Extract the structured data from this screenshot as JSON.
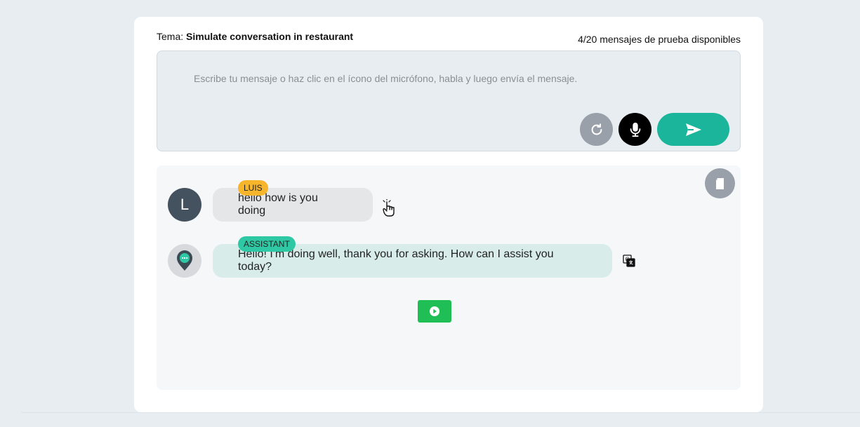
{
  "header": {
    "topic_label": "Tema:",
    "topic_value": "Simulate conversation in restaurant",
    "counter": "4/20 mensajes de prueba disponibles"
  },
  "composer": {
    "value": "",
    "placeholder": "Escribe tu mensaje o haz clic en el ícono del micrófono, habla y luego envía el mensaje."
  },
  "chat": {
    "messages": [
      {
        "role_tag": "LUIS",
        "avatar_letter": "L",
        "text": "hello how is you doing"
      },
      {
        "role_tag": "ASSISTANT",
        "text": "Hello! I'm doing well, thank you for asking. How can I assist you today?"
      }
    ]
  },
  "colors": {
    "accent": "#1ab59a",
    "user_tag": "#f6b52b",
    "assistant_tag": "#2ec9a4",
    "play_button": "#20bf55"
  },
  "icons": {
    "refresh": "refresh-icon",
    "mic": "microphone-icon",
    "send": "send-icon",
    "clear": "clear-chat-icon",
    "translate": "translate-icon",
    "play": "play-icon"
  }
}
